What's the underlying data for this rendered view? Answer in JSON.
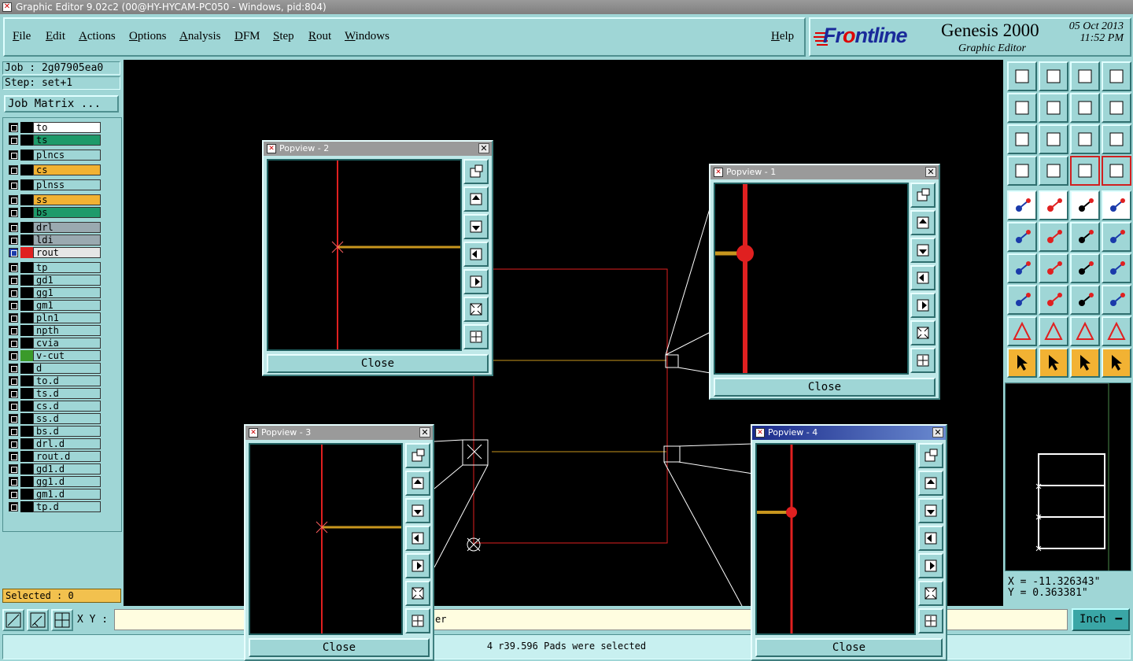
{
  "window": {
    "title": "Graphic Editor 9.02c2 (00@HY-HYCAM-PC050 - Windows, pid:804)"
  },
  "menu": [
    "File",
    "Edit",
    "Actions",
    "Options",
    "Analysis",
    "DFM",
    "Step",
    "Rout",
    "Windows"
  ],
  "help": "Help",
  "brand": {
    "logo_a": "F",
    "logo_b": "r",
    "logo_c": "ontline",
    "product": "Genesis 2000",
    "subtitle": "Graphic Editor",
    "date": "05 Oct 2013",
    "time": "11:52 PM"
  },
  "job": {
    "job": "Job : 2g07905ea0",
    "step": "Step: set+1",
    "matrix_button": "Job Matrix ..."
  },
  "layers": [
    {
      "name": "to",
      "color": "#ffffff"
    },
    {
      "name": "ts",
      "color": "#1e9a6a"
    },
    {
      "name": "plncs",
      "color": "#9fd6d6"
    },
    {
      "name": "cs",
      "color": "#f2b233"
    },
    {
      "name": "plnss",
      "color": "#9fd6d6"
    },
    {
      "name": "ss",
      "color": "#f2b233"
    },
    {
      "name": "bs",
      "color": "#1e9a6a"
    },
    {
      "name": "drl",
      "color": "#9aa9b0"
    },
    {
      "name": "ldi",
      "color": "#9aa9b0"
    },
    {
      "name": "rout",
      "color": "#e6e6e6"
    },
    {
      "name": "tp",
      "color": "#9fd6d6"
    },
    {
      "name": "gd1",
      "color": "#9fd6d6"
    },
    {
      "name": "gg1",
      "color": "#9fd6d6"
    },
    {
      "name": "gm1",
      "color": "#9fd6d6"
    },
    {
      "name": "pln1",
      "color": "#9fd6d6"
    },
    {
      "name": "npth",
      "color": "#9fd6d6"
    },
    {
      "name": "cvia",
      "color": "#9fd6d6"
    },
    {
      "name": "v-cut",
      "color": "#9fd6d6"
    },
    {
      "name": "d",
      "color": "#9fd6d6"
    },
    {
      "name": "to.d",
      "color": "#9fd6d6"
    },
    {
      "name": "ts.d",
      "color": "#9fd6d6"
    },
    {
      "name": "cs.d",
      "color": "#9fd6d6"
    },
    {
      "name": "ss.d",
      "color": "#9fd6d6"
    },
    {
      "name": "bs.d",
      "color": "#9fd6d6"
    },
    {
      "name": "drl.d",
      "color": "#9fd6d6"
    },
    {
      "name": "rout.d",
      "color": "#9fd6d6"
    },
    {
      "name": "gd1.d",
      "color": "#9fd6d6"
    },
    {
      "name": "gg1.d",
      "color": "#9fd6d6"
    },
    {
      "name": "gm1.d",
      "color": "#9fd6d6"
    },
    {
      "name": "tp.d",
      "color": "#9fd6d6"
    }
  ],
  "selected": "Selected : 0",
  "xy": {
    "label": "X Y :",
    "input_value": "",
    "hint_fragment": "er"
  },
  "units": "Inch",
  "status": "4 r39.596 Pads were selected",
  "cursor": {
    "x": "X = -11.326343\"",
    "y": "Y = 0.363381\""
  },
  "popviews": [
    {
      "title": "Popview - 2",
      "close": "Close"
    },
    {
      "title": "Popview - 1",
      "close": "Close"
    },
    {
      "title": "Popview - 3",
      "close": "Close"
    },
    {
      "title": "Popview - 4",
      "close": "Close"
    }
  ],
  "colors": {
    "panel": "#9fd6d6",
    "rout": "#e02020",
    "trace": "#c8961e",
    "selected": "#f2c14e"
  }
}
